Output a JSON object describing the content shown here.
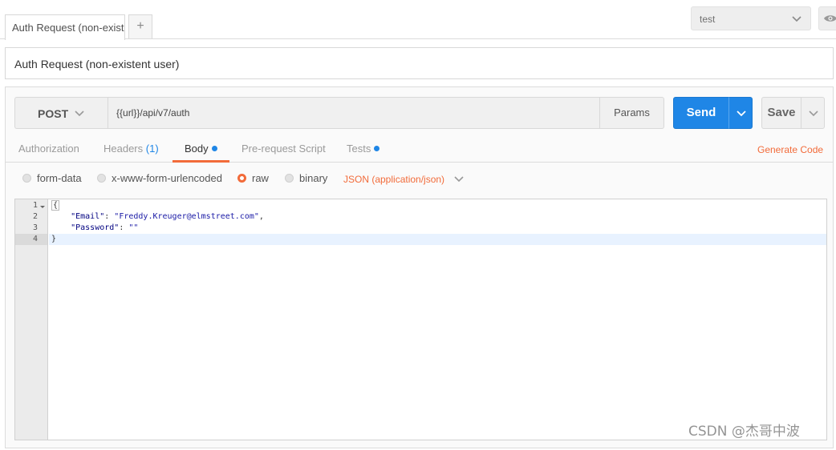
{
  "tabs": [
    {
      "label": "Auth Request (non-existe"
    }
  ],
  "new_tab_label": "+",
  "environment": {
    "selected": "test"
  },
  "request": {
    "name": "Auth Request (non-existent user)",
    "method": "POST",
    "url": "{{url}}/api/v7/auth",
    "params_label": "Params",
    "send_label": "Send",
    "save_label": "Save"
  },
  "subtabs": {
    "authorization": "Authorization",
    "headers": "Headers",
    "headers_count": "(1)",
    "body": "Body",
    "prerequest": "Pre-request Script",
    "tests": "Tests",
    "active": "Body"
  },
  "generate_code_label": "Generate Code",
  "body_modes": {
    "form_data": "form-data",
    "urlencoded": "x-www-form-urlencoded",
    "raw": "raw",
    "binary": "binary",
    "selected": "raw"
  },
  "content_type": "JSON (application/json)",
  "editor": {
    "line_numbers": [
      "1",
      "2",
      "3",
      "4"
    ],
    "current_line": 4,
    "lines": [
      {
        "text": "{"
      },
      {
        "indent": "    ",
        "key": "\"Email\"",
        "sep": ": ",
        "value": "\"Freddy.Kreuger@elmstreet.com\"",
        "tail": ","
      },
      {
        "indent": "    ",
        "key": "\"Password\"",
        "sep": ": ",
        "value": "\"\"",
        "tail": ""
      },
      {
        "text": "}"
      }
    ]
  },
  "watermark": "CSDN @杰哥中波",
  "colors": {
    "accent_orange": "#f26b3a",
    "send_blue": "#1f86e6",
    "json_key": "#000080",
    "json_string": "#1a1aa6"
  },
  "icons": {
    "env_dropdown": "chevron-down-icon",
    "env_quick_look": "eye-icon",
    "method_dropdown": "chevron-down-icon",
    "send_dropdown": "chevron-down-icon",
    "save_dropdown": "chevron-down-icon",
    "content_type_dropdown": "chevron-down-icon"
  }
}
